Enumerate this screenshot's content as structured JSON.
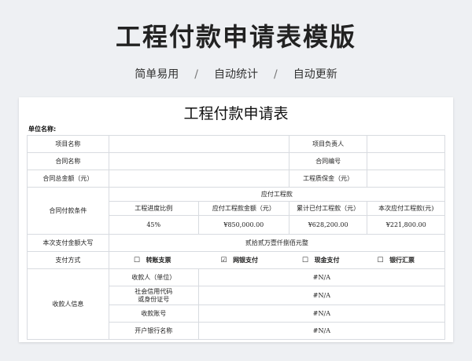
{
  "header": {
    "title": "工程付款申请表模版",
    "tags": [
      "简单易用",
      "自动统计",
      "自动更新"
    ],
    "separator": "/"
  },
  "form": {
    "title": "工程付款申请表",
    "unit_label": "单位名称:",
    "project_name_label": "项目名称",
    "project_lead_label": "项目负责人",
    "contract_name_label": "合同名称",
    "contract_no_label": "合同编号",
    "contract_total_label": "合同总金额（元）",
    "quality_deposit_label": "工程质保金（元）",
    "payment_terms_label": "合同付款条件",
    "payable_header": "应付工程款",
    "payable_columns": [
      "工程进度比例",
      "应付工程款金额（元）",
      "累计已付工程款（元）",
      "本次应付工程款(元)"
    ],
    "payable_values": [
      "45%",
      "¥850,000.00",
      "¥628,200.00",
      "¥221,800.00"
    ],
    "amount_in_words_label": "本次支付金额大写",
    "amount_in_words": "贰拾贰万壹仟捌佰元整",
    "payment_method_label": "支付方式",
    "payment_options": [
      {
        "box": "☐",
        "label": "转账支票"
      },
      {
        "box": "☑",
        "label": "网银支付"
      },
      {
        "box": "☐",
        "label": "现金支付"
      },
      {
        "box": "☐",
        "label": "银行汇票"
      }
    ],
    "payee_info_label": "收款人信息",
    "payee_rows": [
      {
        "label": "收款人（单位）",
        "value": "#N/A"
      },
      {
        "label": "社会信用代码\n或身份证号",
        "value": "#N/A"
      },
      {
        "label": "收款账号",
        "value": "#N/A"
      },
      {
        "label": "开户银行名称",
        "value": "#N/A"
      }
    ]
  }
}
